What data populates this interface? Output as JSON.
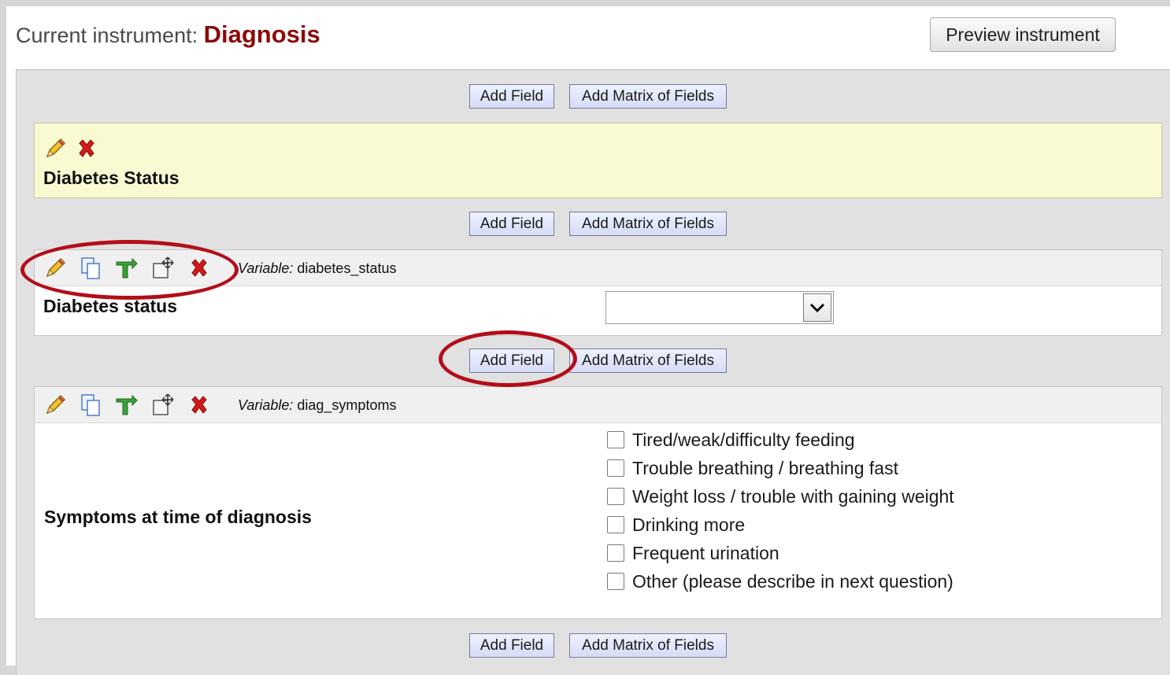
{
  "header": {
    "prefix": "Current instrument:",
    "instrument_name": "Diagnosis",
    "preview_button": "Preview instrument"
  },
  "add_buttons": {
    "add_field": "Add Field",
    "add_matrix": "Add Matrix of Fields"
  },
  "section_header": {
    "title": "Diabetes Status",
    "icons": [
      "pencil-icon",
      "delete-icon"
    ]
  },
  "fields": [
    {
      "variable_prefix": "Variable:",
      "variable_name": "diabetes_status",
      "label": "Diabetes status",
      "type": "dropdown",
      "selected_value": ""
    },
    {
      "variable_prefix": "Variable:",
      "variable_name": "diag_symptoms",
      "label": "Symptoms at time of diagnosis",
      "type": "checkbox",
      "options": [
        "Tired/weak/difficulty feeding",
        "Trouble breathing / breathing fast",
        "Weight loss / trouble with gaining weight",
        "Drinking more",
        "Frequent urination",
        "Other (please describe in next question)"
      ]
    }
  ],
  "field_toolbar_icons": [
    "pencil-icon",
    "copy-icon",
    "branching-icon",
    "move-icon",
    "delete-icon"
  ],
  "colors": {
    "instrument_name": "#8b0a0a",
    "section_background": "#fafad2",
    "annotation": "#b30d1a",
    "button_background": "#dde2fb"
  }
}
